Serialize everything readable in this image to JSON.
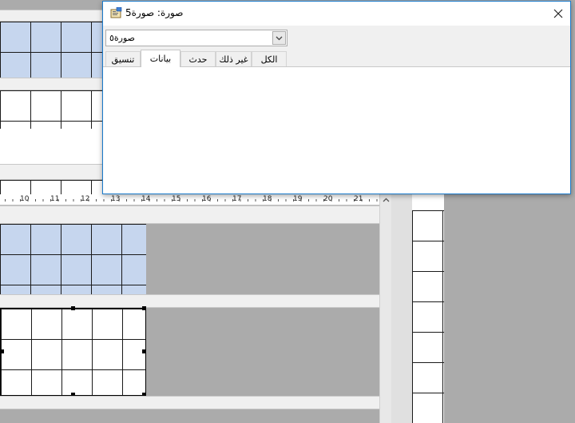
{
  "property_sheet": {
    "title": "صورة: صورة5",
    "object_selector_value": "صورة٥",
    "tabs": [
      {
        "label": "الكل"
      },
      {
        "label": "غير ذلك"
      },
      {
        "label": "حدث"
      },
      {
        "label": "بيانات",
        "active": true
      },
      {
        "label": "تنسيق"
      }
    ]
  },
  "ruler": {
    "labels": [
      "10",
      "11",
      "12",
      "13",
      "14",
      "15",
      "16",
      "17",
      "18",
      "19",
      "20",
      "21"
    ]
  },
  "colors": {
    "window_border": "#1979ca",
    "selected_band": "#c6d6ee",
    "designer_background": "#ababab"
  },
  "icons": {
    "window_icon": "property-sheet-icon",
    "close": "close-icon",
    "dropdown": "chevron-down-icon",
    "scroll_up": "chevron-up-icon"
  }
}
